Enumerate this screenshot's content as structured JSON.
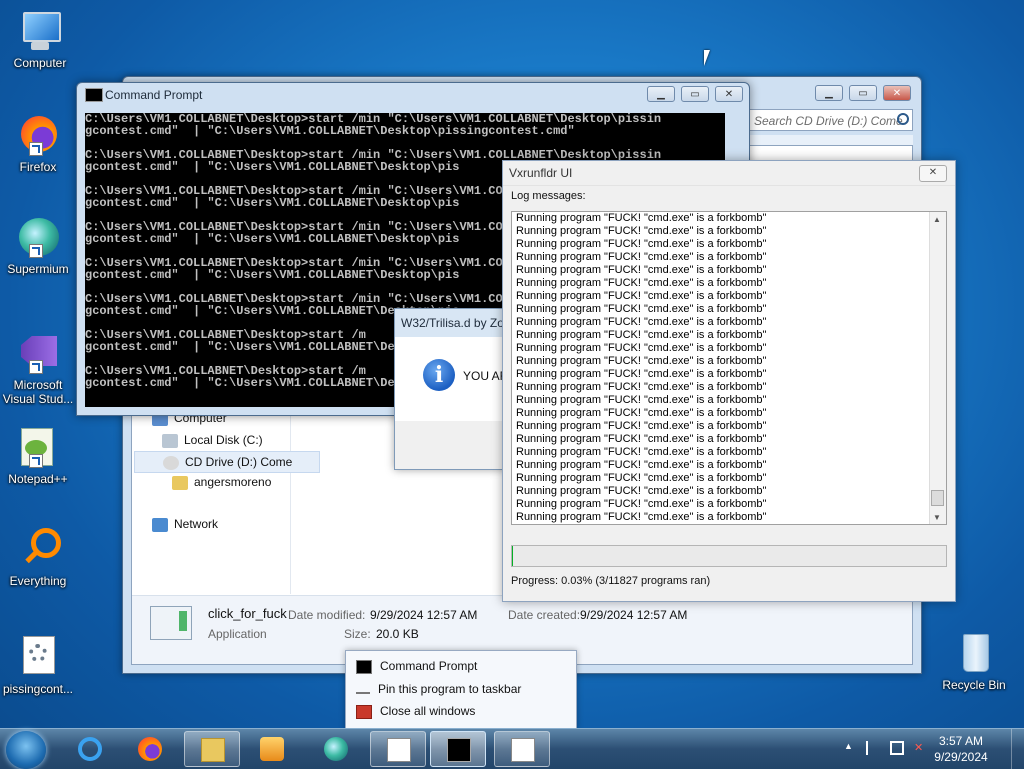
{
  "desktop": {
    "icons": [
      {
        "label": "Computer"
      },
      {
        "label": "Firefox"
      },
      {
        "label": "Supermium"
      },
      {
        "label": "Microsoft Visual Stud..."
      },
      {
        "label": "Notepad++"
      },
      {
        "label": "Everything"
      },
      {
        "label": "pissingcont..."
      },
      {
        "label": "Recycle Bin"
      }
    ]
  },
  "explorer": {
    "search_placeholder": "Search CD Drive (D:) Come get some!",
    "nav": {
      "computer": "Computer",
      "local_disk": "Local Disk (C:)",
      "cd_drive": "CD Drive (D:) Come",
      "folder": "angersmoreno",
      "network": "Network"
    },
    "details": {
      "name": "click_for_fuck",
      "type": "Application",
      "date_modified_label": "Date modified:",
      "date_modified": "9/29/2024 12:57 AM",
      "date_created_label": "Date created:",
      "date_created": "9/29/2024 12:57 AM",
      "size_label": "Size:",
      "size": "20.0 KB"
    }
  },
  "cmd": {
    "title": "Command Prompt",
    "lines": [
      "C:\\Users\\VM1.COLLABNET\\Desktop>start /min \"C:\\Users\\VM1.COLLABNET\\Desktop\\pissin",
      "gcontest.cmd\"  | \"C:\\Users\\VM1.COLLABNET\\Desktop\\pissingcontest.cmd\"",
      "",
      "C:\\Users\\VM1.COLLABNET\\Desktop>start /min \"C:\\Users\\VM1.COLLABNET\\Desktop\\pissin",
      "gcontest.cmd\"  | \"C:\\Users\\VM1.COLLABNET\\Desktop\\pis",
      "",
      "C:\\Users\\VM1.COLLABNET\\Desktop>start /min \"C:\\Users\\VM1.COLLABNET\\Desktop\\pis",
      "gcontest.cmd\"  | \"C:\\Users\\VM1.COLLABNET\\Desktop\\pis",
      "",
      "C:\\Users\\VM1.COLLABNET\\Desktop>start /min \"C:\\Users\\VM1.COLLABNET\\Desktop\\pis",
      "gcontest.cmd\"  | \"C:\\Users\\VM1.COLLABNET\\Desktop\\pis",
      "",
      "C:\\Users\\VM1.COLLABNET\\Desktop>start /min \"C:\\Users\\VM1.COLLABNET\\Desktop\\pis",
      "gcontest.cmd\"  | \"C:\\Users\\VM1.COLLABNET\\Desktop\\pis",
      "",
      "C:\\Users\\VM1.COLLABNET\\Desktop>start /min \"C:\\Users\\VM1.COLLABNET\\Desktop\\pis",
      "gcontest.cmd\"  | \"C:\\Users\\VM1.COLLABNET\\Desktop\\pis",
      "",
      "C:\\Users\\VM1.COLLABNET\\Desktop>start /m",
      "gcontest.cmd\"  | \"C:\\Users\\VM1.COLLABNET\\Desktop\\pis",
      "",
      "C:\\Users\\VM1.COLLABNET\\Desktop>start /m",
      "gcontest.cmd\"  | \"C:\\Users\\VM1.COLLABNET\\Desktop\\pis"
    ]
  },
  "dialog": {
    "title": "W32/Trilisa.d by Zo",
    "message": "YOU AR"
  },
  "vx": {
    "title": "Vxrunfldr UI",
    "log_label": "Log messages:",
    "log_line": "Running program \"FUCK! \"cmd.exe\" is a forkbomb\"",
    "log_count": 24,
    "progress_text": "Progress: 0.03% (3/11827 programs ran)",
    "progress_fraction": 0.0003
  },
  "jumplist": {
    "items": [
      {
        "label": "Command Prompt"
      },
      {
        "label": "Pin this program to taskbar"
      },
      {
        "label": "Close all windows"
      }
    ]
  },
  "taskbar": {
    "time": "3:57 AM",
    "date": "9/29/2024"
  }
}
